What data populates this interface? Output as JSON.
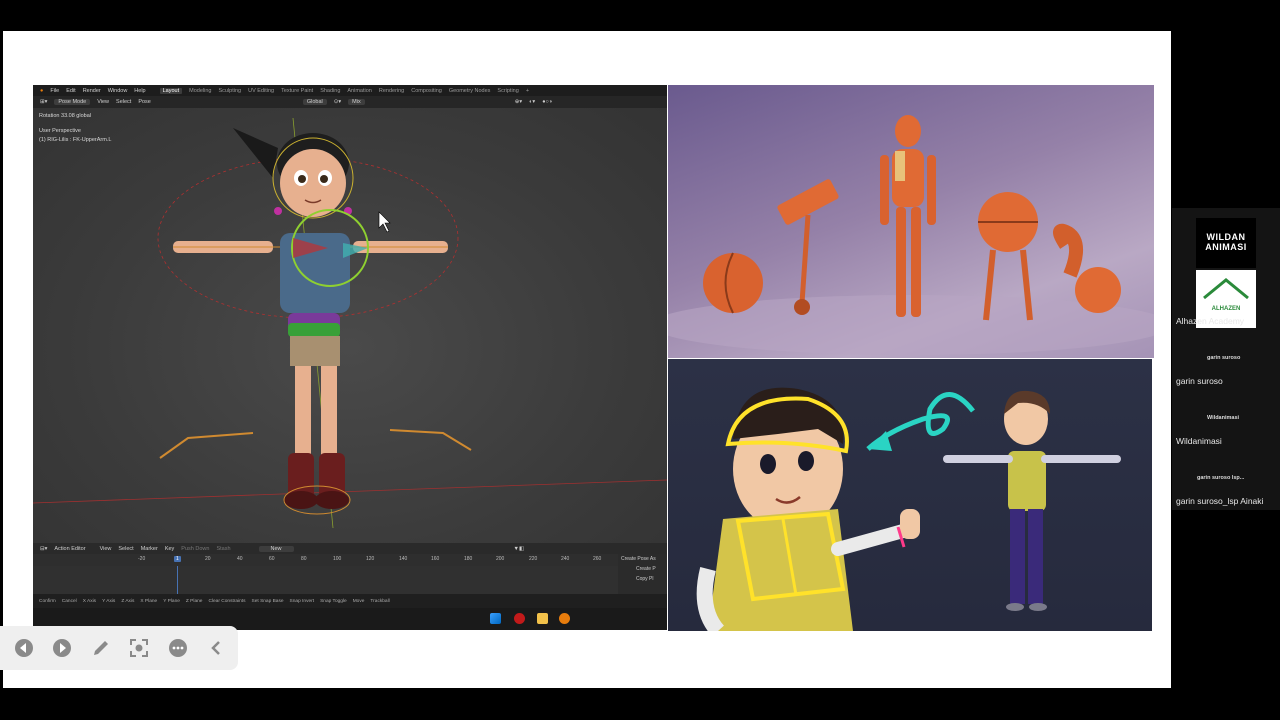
{
  "blender": {
    "menu": [
      "File",
      "Edit",
      "Render",
      "Window",
      "Help"
    ],
    "workspaces": [
      "Layout",
      "Modeling",
      "Sculpting",
      "UV Editing",
      "Texture Paint",
      "Shading",
      "Animation",
      "Rendering",
      "Compositing",
      "Geometry Nodes",
      "Scripting",
      "+"
    ],
    "active_workspace_index": 0,
    "toolbar": {
      "mode": "Pose Mode",
      "view": "View",
      "select": "Select",
      "pose": "Pose",
      "orientation": "Global",
      "pivot": "Mix"
    },
    "viewport": {
      "rotation_info": "Rotation 33.08 global",
      "perspective": "User Perspective",
      "object_info": "(1) RIG-Lilis : FK-UpperArm.L"
    },
    "timeline": {
      "editor": "Action Editor",
      "view": "View",
      "select": "Select",
      "marker": "Marker",
      "key": "Key",
      "push_down": "Push Down",
      "stash": "Stash",
      "new_label": "New",
      "frames": [
        "-20",
        "1",
        "20",
        "40",
        "60",
        "80",
        "100",
        "120",
        "140",
        "160",
        "180",
        "200",
        "220",
        "240",
        "260"
      ],
      "current_frame": "1"
    },
    "side_panel": [
      "Create Pose As",
      "Create P",
      "Copy Pl"
    ],
    "status": [
      "Confirm",
      "Cancel",
      "X Axis",
      "Y Axis",
      "Z Axis",
      "X Plane",
      "Y Plane",
      "Z Plane",
      "Clear Constraints",
      "Set Snap Base",
      "Snap Invert",
      "Snap Toggle",
      "Move",
      "Trackball"
    ]
  },
  "participants": [
    {
      "name": "Alhazen Academy",
      "tile": "alhazen-logo"
    },
    {
      "name": "garin suroso",
      "tile_text": "garin suroso"
    },
    {
      "name": "Wildanimasi",
      "tile_text": "Wildanimasi"
    },
    {
      "name": "garin suroso_lsp Ainaki",
      "tile_text": "garin suroso lsp..."
    }
  ],
  "logo_text": {
    "wildan": "WILDAN ANIMASI",
    "alhazen": "ALHAZEN ACADEMY"
  },
  "controls": [
    "previous-icon",
    "play-icon",
    "pen-icon",
    "focus-icon",
    "more-icon",
    "collapse-icon"
  ]
}
